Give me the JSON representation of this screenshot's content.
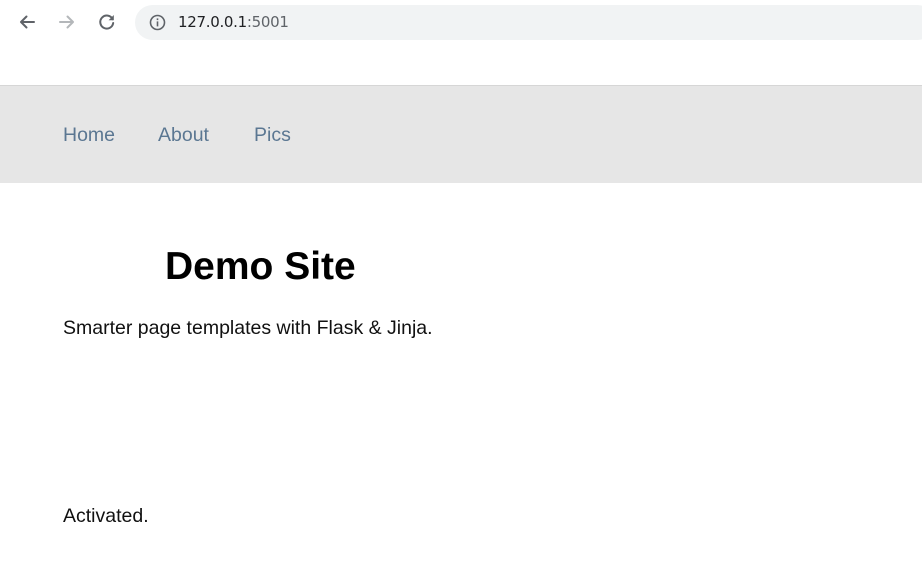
{
  "browser": {
    "url_host": "127.0.0.1",
    "url_port": ":5001",
    "icons": {
      "back": "arrow-left-icon",
      "forward": "arrow-right-icon",
      "reload": "reload-icon",
      "site_info": "info-circle-icon"
    }
  },
  "nav": {
    "items": [
      {
        "label": "Home"
      },
      {
        "label": "About"
      },
      {
        "label": "Pics"
      }
    ],
    "background": "#e6e6e6",
    "link_color": "#5b7792"
  },
  "main": {
    "title": "Demo Site",
    "subtitle": "Smarter page templates with Flask & Jinja.",
    "status": "Activated."
  }
}
